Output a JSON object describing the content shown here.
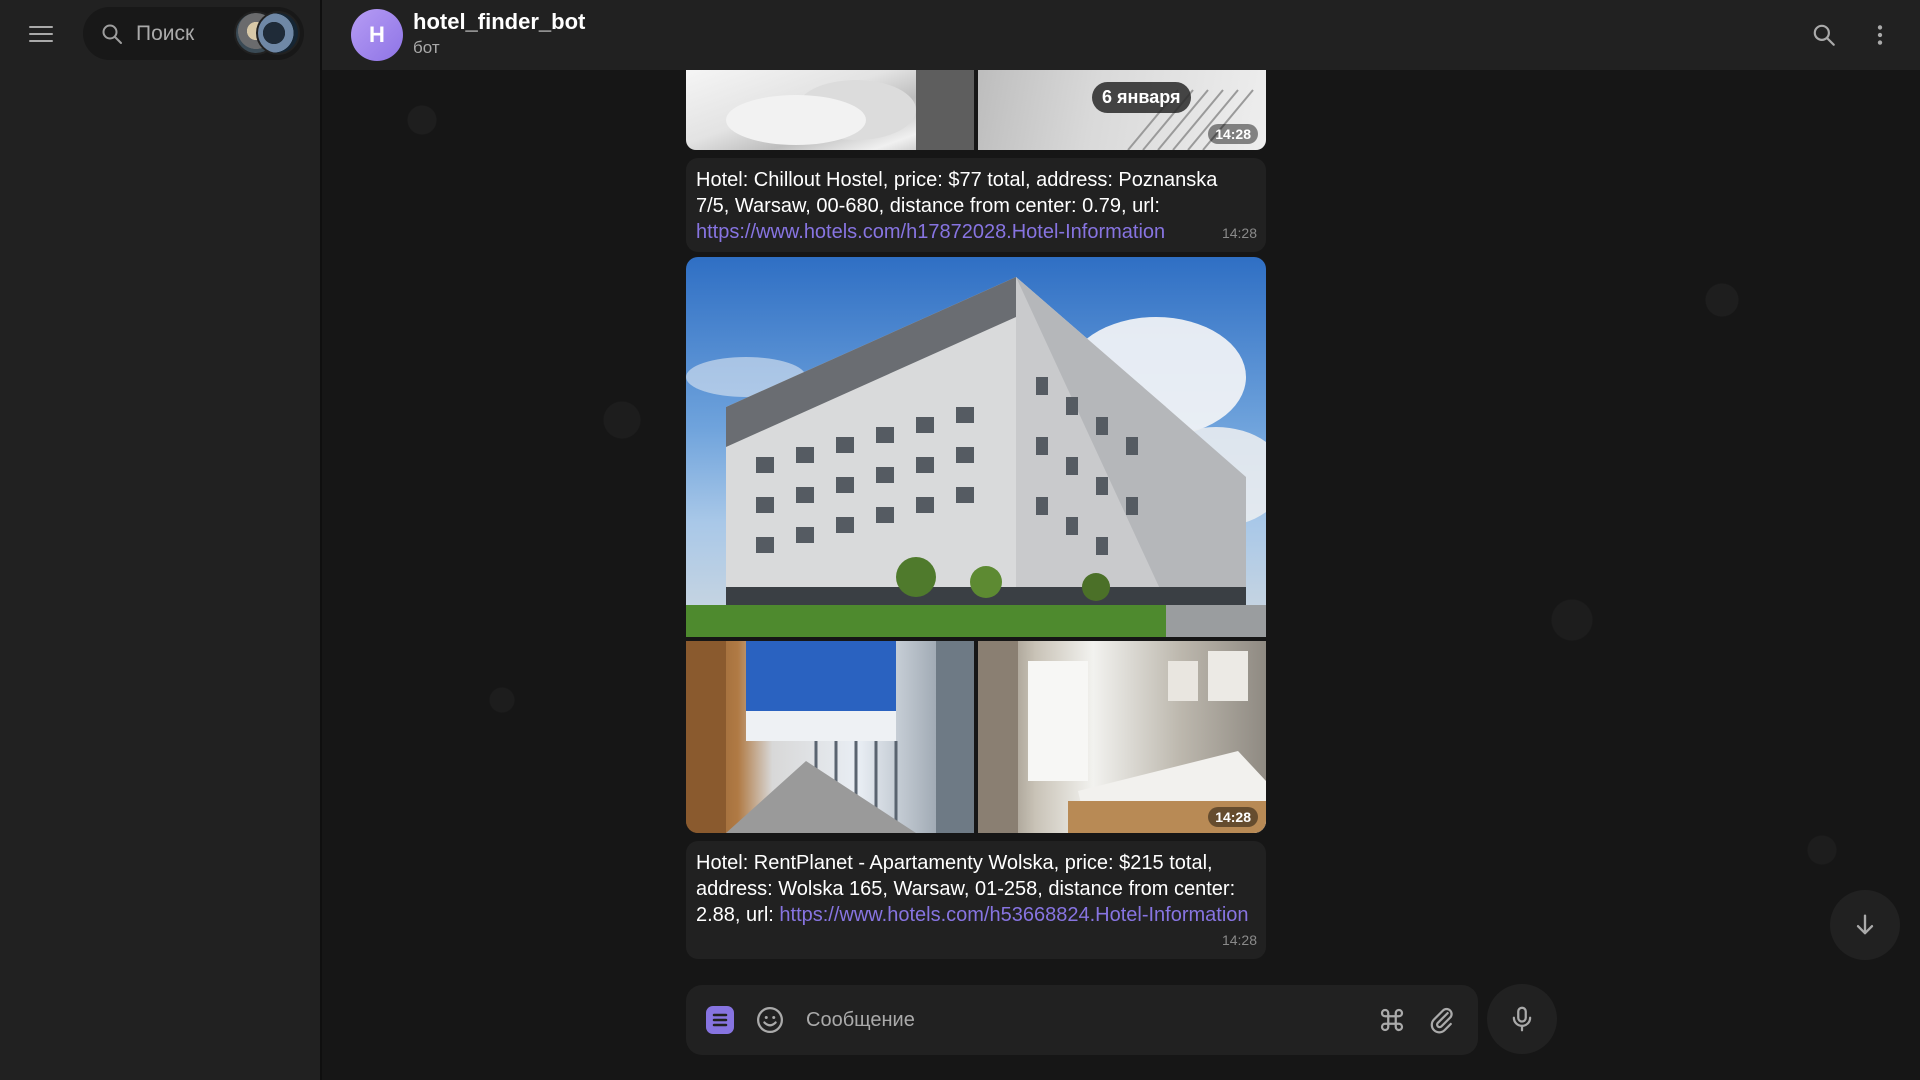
{
  "sidebar": {
    "search_placeholder": "Поиск",
    "icons": [
      "menu-icon",
      "search-icon"
    ]
  },
  "chat_header": {
    "avatar_letter": "H",
    "avatar_color": "#9c86ee",
    "title": "hotel_finder_bot",
    "subtitle": "бот",
    "icons": [
      "search-icon",
      "more-vertical-icon"
    ]
  },
  "date_separator": "6 января",
  "messages": [
    {
      "type": "album",
      "time": "14:28"
    },
    {
      "type": "text",
      "text": "Hotel: Chillout Hostel, price: $77 total, address: Poznanska 7/5, Warsaw, 00-680, distance from center: 0.79, url: ",
      "link": "https://www.hotels.com/h17872028.Hotel-Information",
      "time": "14:28"
    },
    {
      "type": "album",
      "time": "14:28"
    },
    {
      "type": "text",
      "text": "Hotel: RentPlanet - Apartamenty Wolska, price: $215 total, address: Wolska 165, Warsaw, 01-258, distance from center: 2.88, url: ",
      "link": "https://www.hotels.com/h53668824.Hotel-Information",
      "time": "14:28"
    }
  ],
  "composer": {
    "placeholder": "Сообщение",
    "icons": [
      "commands-menu-icon",
      "emoji-icon",
      "bot-commands-icon",
      "attach-icon",
      "microphone-icon"
    ]
  },
  "colors": {
    "accent": "#8774e1",
    "bubble": "#212121",
    "panel": "#212121",
    "background": "#161616"
  }
}
